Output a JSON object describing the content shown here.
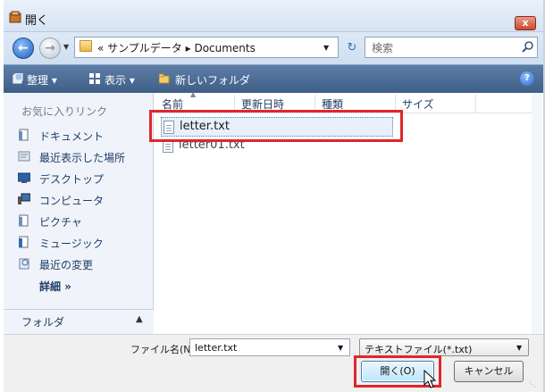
{
  "window": {
    "title": "開く",
    "close_label": "x"
  },
  "address": {
    "breadcrumb": "« サンプルデータ ▸ Documents",
    "search_placeholder": "検索"
  },
  "toolbar": {
    "organize": "整理 ▾",
    "views": "表示 ▾",
    "new_folder": "新しいフォルダ",
    "help": "?"
  },
  "nav": {
    "favorites_heading": "お気に入りリンク",
    "items": [
      {
        "label": "ドキュメント",
        "icon": "documents-icon"
      },
      {
        "label": "最近表示した場所",
        "icon": "recent-places-icon"
      },
      {
        "label": "デスクトップ",
        "icon": "desktop-icon"
      },
      {
        "label": "コンピュータ",
        "icon": "computer-icon"
      },
      {
        "label": "ピクチャ",
        "icon": "pictures-icon"
      },
      {
        "label": "ミュージック",
        "icon": "music-icon"
      },
      {
        "label": "最近の変更",
        "icon": "recently-changed-icon"
      }
    ],
    "more": "詳細 »",
    "folders_label": "フォルダ"
  },
  "files": {
    "columns": [
      "名前",
      "更新日時",
      "種類",
      "サイズ"
    ],
    "rows": [
      {
        "name": "letter.txt"
      },
      {
        "name": "letter01.txt"
      }
    ]
  },
  "bottom": {
    "filename_label": "ファイル名(N):",
    "filename_value": "letter.txt",
    "filetype_value": "テキストファイル(*.txt)",
    "open_label": "開く(O)",
    "cancel_label": "キャンセル"
  },
  "colors": {
    "annotation_red": "#e0262b",
    "toolbar_blue": "#4a6b94",
    "nav_text": "#1f3d66"
  }
}
